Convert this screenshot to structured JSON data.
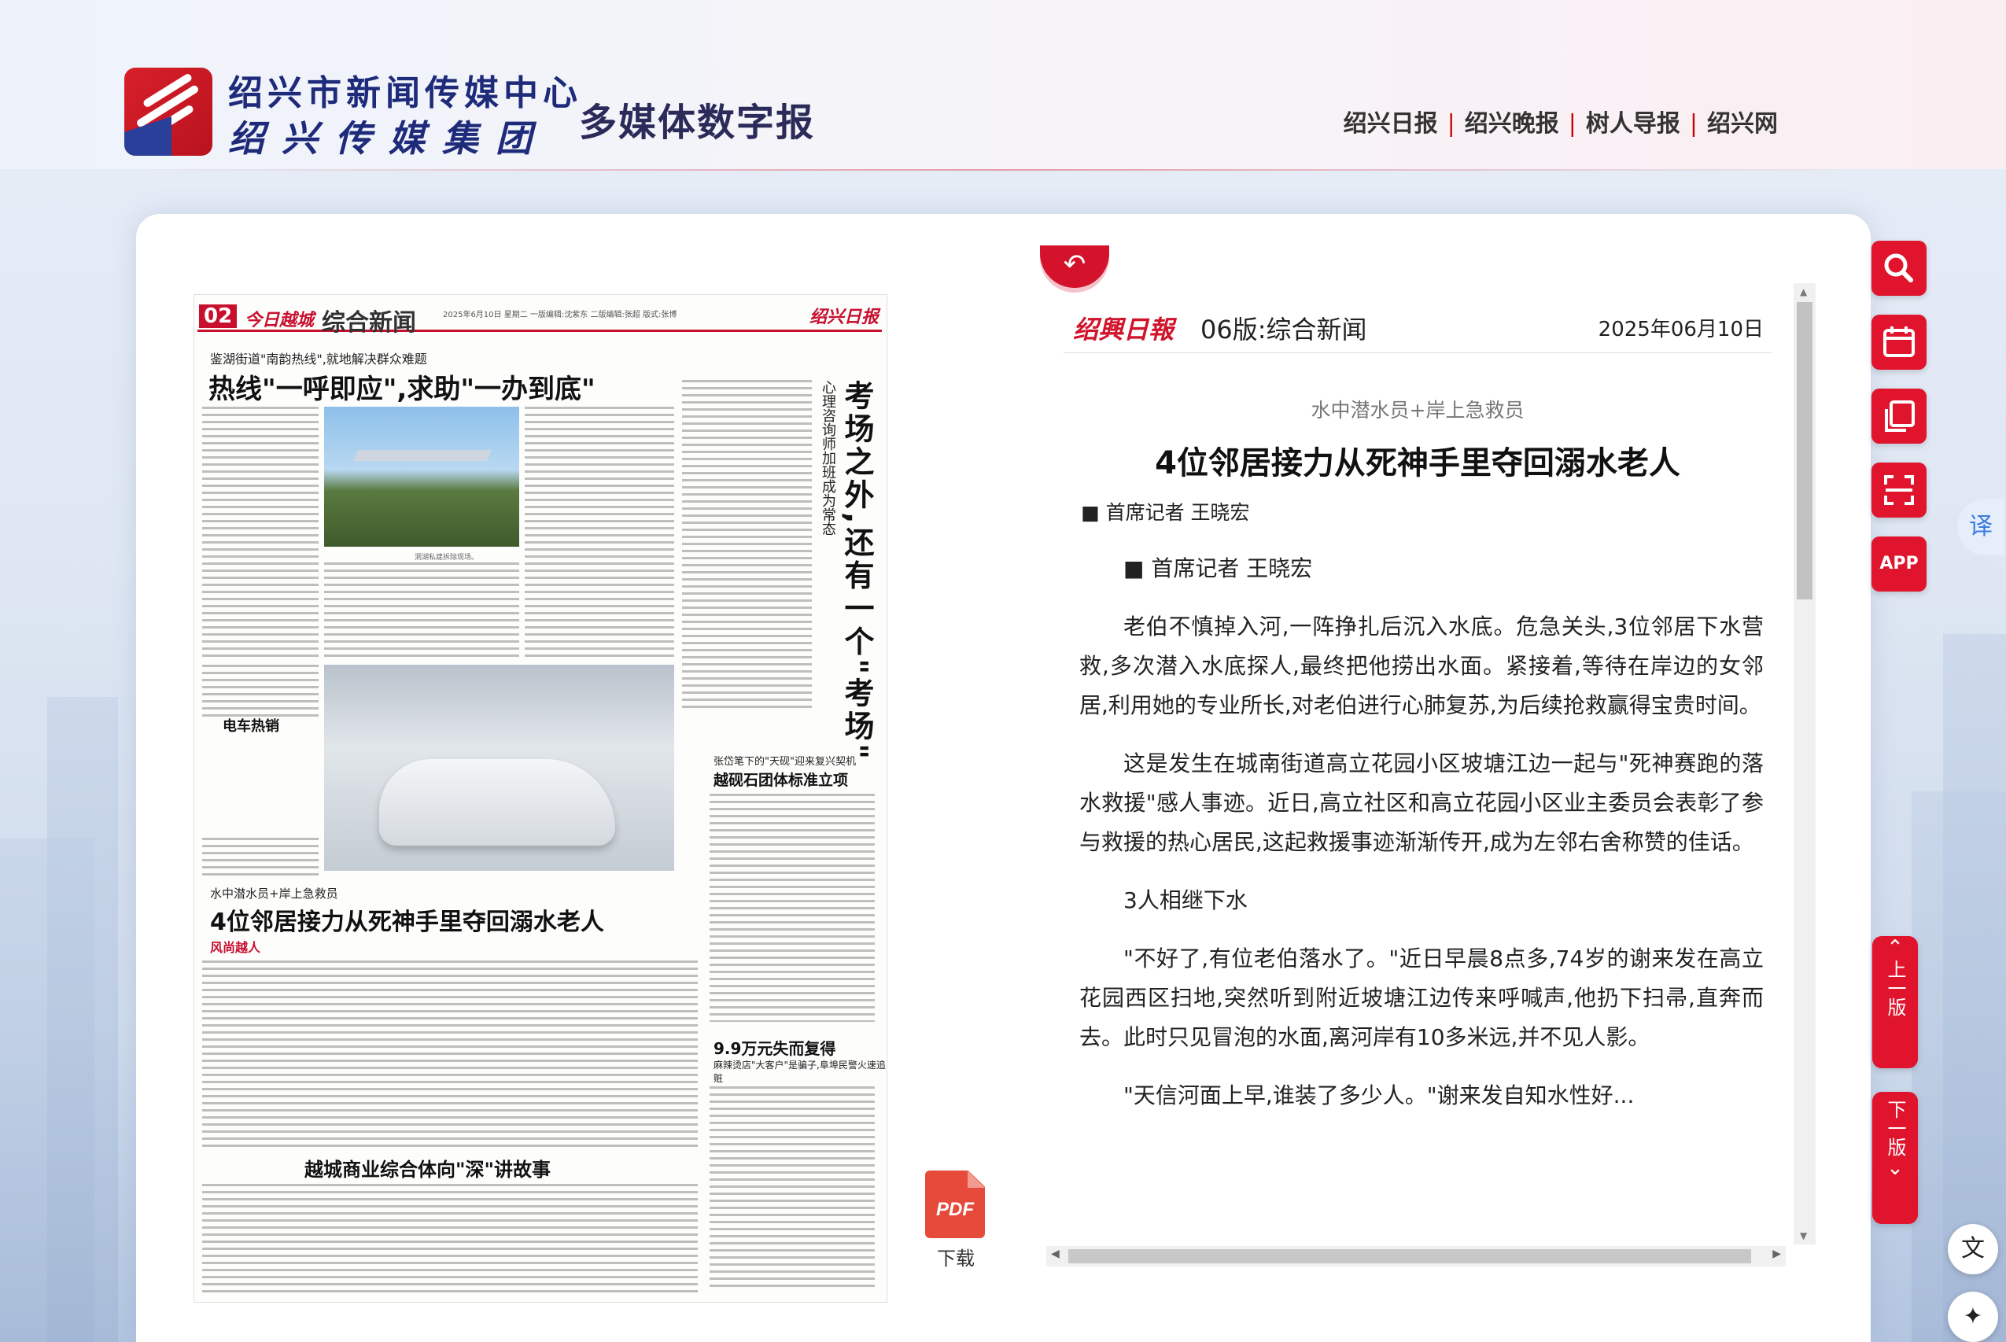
{
  "header": {
    "brand_line1": "绍兴市新闻传媒中心",
    "brand_line2": "绍兴传媒集团",
    "site_title": "多媒体数字报",
    "links": [
      "绍兴日报",
      "绍兴晚报",
      "树人导报",
      "绍兴网"
    ]
  },
  "page": {
    "page_no": "02",
    "sub_brand": "今日越城",
    "section": "综合新闻",
    "meta": "2025年6月10日 星期二 一版编辑:沈紫东 二版编辑:张超 版式:张博",
    "paper_logo": "绍兴日报",
    "story1_kicker": "鉴湖街道\"南韵热线\",就地解决群众难题",
    "story1_head": "热线\"一呼即应\",求助\"一办到底\"",
    "photo1_caption": "洞湖私建拆除现场。",
    "vert_title": "考场之外,还有一个\"考场\"",
    "vert_sub": "心理咨询师加班成为常态",
    "car_label": "电车热销",
    "story2_kicker": "张岱笔下的\"天砚\"迎来复兴契机",
    "story2_head": "越砚石团体标准立项",
    "story3_kicker": "水中潜水员+岸上急救员",
    "story3_head": "4位邻居接力从死神手里夺回溺水老人",
    "story3_tag": "风尚越人",
    "story4_head": "9.9万元失而复得",
    "story4_sub": "麻辣烫店\"大客户\"是骗子,阜埠民警火速追赃",
    "story5_head": "越城商业综合体向\"深\"讲故事",
    "pdf_icon_text": "PDF",
    "pdf_label": "下载"
  },
  "article": {
    "back_icon": "back-arrow-icon",
    "paper_name": "绍興日報",
    "edition": "06版:综合新闻",
    "date": "2025年06月10日",
    "kicker": "水中潜水员+岸上急救员",
    "title": "4位邻居接力从死神手里夺回溺水老人",
    "byline": "■ 首席记者 王晓宏",
    "paragraphs": [
      "■ 首席记者 王晓宏",
      "老伯不慎掉入河,一阵挣扎后沉入水底。危急关头,3位邻居下水营救,多次潜入水底探人,最终把他捞出水面。紧接着,等待在岸边的女邻居,利用她的专业所长,对老伯进行心肺复苏,为后续抢救赢得宝贵时间。",
      "这是发生在城南街道高立花园小区坡塘江边一起与\"死神赛跑的落水救援\"感人事迹。近日,高立社区和高立花园小区业主委员会表彰了参与救援的热心居民,这起救援事迹渐渐传开,成为左邻右舍称赞的佳话。",
      "3人相继下水",
      "\"不好了,有位老伯落水了。\"近日早晨8点多,74岁的谢来发在高立花园西区扫地,突然听到附近坡塘江边传来呼喊声,他扔下扫帚,直奔而去。此时只见冒泡的水面,离河岸有10多米远,并不见人影。",
      "\"天信河面上早,谁装了多少人。\"谢来发自知水性好..."
    ]
  },
  "tools": {
    "search": "search-icon",
    "calendar": "calendar-icon",
    "copy": "copy-icon",
    "scan": "scan-icon",
    "app": "APP",
    "translate": "译",
    "prev_page": "上一版",
    "next_page": "下一版"
  },
  "colors": {
    "accent": "#e0142c",
    "brand_blue": "#1e2a7a"
  }
}
